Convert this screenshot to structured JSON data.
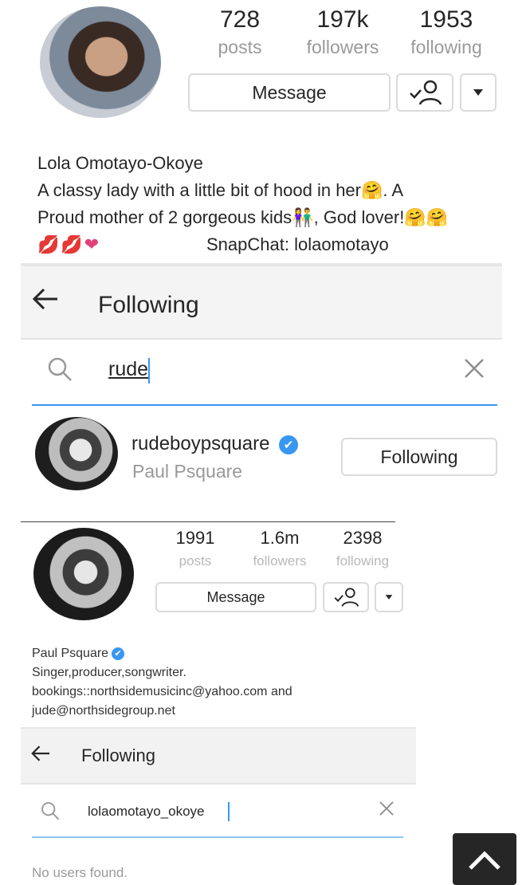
{
  "profile_top": {
    "stats": [
      {
        "value": "728",
        "label": "posts"
      },
      {
        "value": "197k",
        "label": "followers"
      },
      {
        "value": "1953",
        "label": "following"
      }
    ],
    "message_label": "Message",
    "bio": {
      "name": "Lola Omotayo-Okoye",
      "line1": "A classy lady with a little bit of hood in her",
      "line1_end": ". A",
      "line2": "Proud mother of 2 gorgeous kids",
      "line2_mid": ", God lover!",
      "snapchat": "SnapChat: lolaomotayo"
    }
  },
  "following_panel_1": {
    "title": "Following",
    "search_query": "rude",
    "result": {
      "username": "rudeboypsquare",
      "full_name": "Paul Psquare",
      "button_label": "Following"
    }
  },
  "profile_second": {
    "stats": [
      {
        "value": "1991",
        "label": "posts"
      },
      {
        "value": "1.6m",
        "label": "followers"
      },
      {
        "value": "2398",
        "label": "following"
      }
    ],
    "message_label": "Message",
    "bio": {
      "name": "Paul Psquare",
      "line1": "Singer,producer,songwriter.",
      "line2": "bookings::northsidemusicinc@yahoo.com and",
      "line3": "jude@northsidegroup.net"
    }
  },
  "following_panel_2": {
    "title": "Following",
    "search_query": "lolaomotayo_okoye",
    "empty_message": "No users found."
  },
  "icons": {
    "accent": "#3897f0"
  }
}
